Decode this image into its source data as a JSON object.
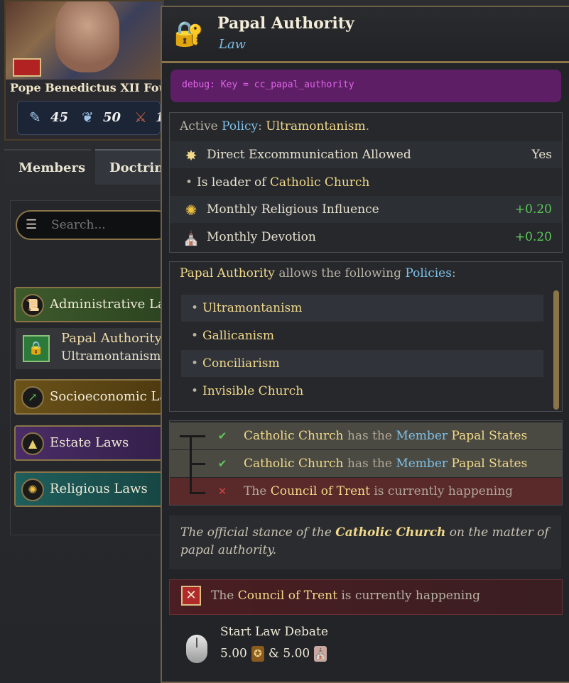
{
  "ruler": {
    "name": "Pope Benedictus XII Fou",
    "stats": [
      {
        "icon": "scroll-icon",
        "value": "45"
      },
      {
        "icon": "dove-icon",
        "value": "50"
      },
      {
        "icon": "crossed-swords-icon",
        "value": "1"
      }
    ]
  },
  "tabs": {
    "members": "Members",
    "doctrine": "Doctrine"
  },
  "search": {
    "placeholder": "Search..."
  },
  "law_list": {
    "admin": "Administrative Laws",
    "papal_authority": "Papal Authority",
    "papal_policy": "Ultramontanism",
    "socio": "Socioeconomic Laws",
    "estate": "Estate Laws",
    "religious": "Religious Laws"
  },
  "tooltip": {
    "title": "Papal Authority",
    "subtitle": "Law",
    "debug": "debug: Key = cc_papal_authority",
    "active": {
      "prefix": "Active ",
      "policy_word": "Policy",
      "colon": ": ",
      "value": "Ultramontanism",
      "suffix": "."
    },
    "effects": [
      {
        "label": "Direct Excommunication Allowed",
        "value": "Yes"
      },
      {
        "label_prefix": "Is leader of ",
        "label_hl": "Catholic Church"
      },
      {
        "label": "Monthly Religious Influence",
        "value": "+0.20"
      },
      {
        "label": "Monthly Devotion",
        "value": "+0.20"
      }
    ],
    "allows": {
      "subject": "Papal Authority",
      "middle": " allows the following ",
      "policies": "Policies",
      "colon": ":"
    },
    "allowed_policies": [
      "Ultramontanism",
      "Gallicanism",
      "Conciliarism",
      "Invisible Church"
    ],
    "conditions": [
      {
        "a": "Catholic Church",
        "b": " has the ",
        "c": "Member",
        "d": "Papal States"
      },
      {
        "a": "Catholic Church",
        "b": " has the ",
        "c": "Member",
        "d": "Papal States"
      },
      {
        "pre": "The ",
        "hl": "Council of Trent",
        "post": " is currently happening"
      }
    ],
    "description": {
      "pre": "The official stance of the ",
      "hl": "Catholic Church",
      "post": " on the matter of papal authority."
    },
    "blocker": {
      "pre": "The ",
      "hl": "Council of Trent",
      "post": " is currently happening"
    },
    "action": {
      "label": "Start Law Debate",
      "cost1": "5.00",
      "amp": "& 5.00"
    }
  },
  "colors": {
    "gold": "#f2d98a",
    "blue": "#7fc0e8",
    "green": "#5ec95a",
    "debug": "#5e1e66"
  }
}
